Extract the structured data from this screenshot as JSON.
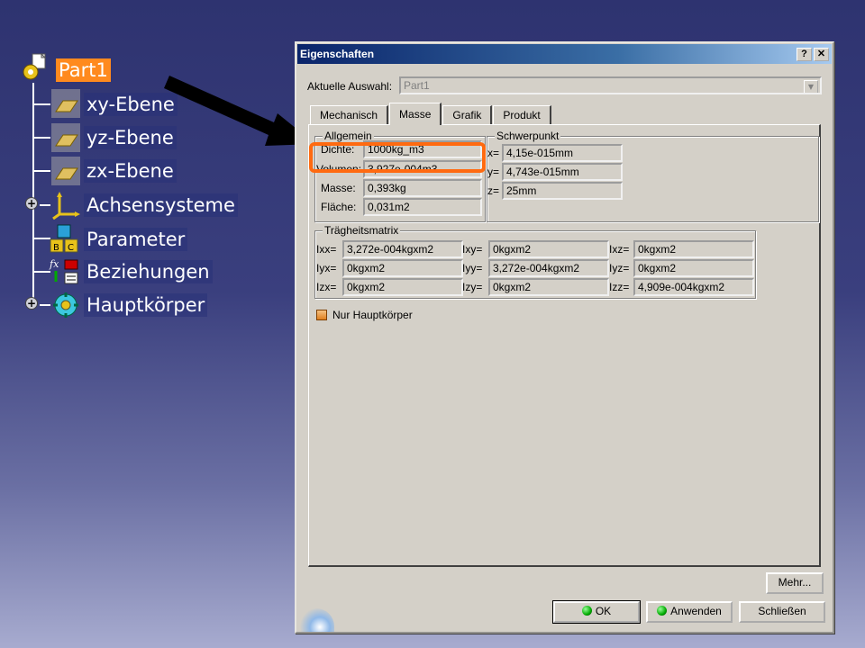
{
  "tree": {
    "root": "Part1",
    "items": [
      {
        "label": "xy-Ebene",
        "icon": "plane-icon"
      },
      {
        "label": "yz-Ebene",
        "icon": "plane-icon"
      },
      {
        "label": "zx-Ebene",
        "icon": "plane-icon"
      },
      {
        "label": "Achsensysteme",
        "icon": "axis-system-icon"
      },
      {
        "label": "Parameter",
        "icon": "parameter-icon"
      },
      {
        "label": "Beziehungen",
        "icon": "relations-icon"
      },
      {
        "label": "Hauptkörper",
        "icon": "body-icon"
      }
    ],
    "selection_color": "#ff8a1e"
  },
  "dialog": {
    "title": "Eigenschaften",
    "help_btn": "?",
    "close_btn": "✕",
    "selection_label": "Aktuelle Auswahl:",
    "selection_value": "Part1",
    "tabs": [
      "Mechanisch",
      "Masse",
      "Grafik",
      "Produkt"
    ],
    "active_tab": "Masse",
    "allgemein": {
      "title": "Allgemein",
      "dichte_label": "Dichte:",
      "dichte_value": "1000kg_m3",
      "volumen_label": "Volumen:",
      "volumen_value": "3,927e-004m3",
      "masse_label": "Masse:",
      "masse_value": "0,393kg",
      "flaeche_label": "Fläche:",
      "flaeche_value": "0,031m2"
    },
    "schwerpunkt": {
      "title": "Schwerpunkt",
      "x_label": "x=",
      "x_value": "4,15e-015mm",
      "y_label": "y=",
      "y_value": "4,743e-015mm",
      "z_label": "z=",
      "z_value": "25mm"
    },
    "traegheit": {
      "title": "Trägheitsmatrix",
      "ixx_label": "Ixx=",
      "ixx": "3,272e-004kgxm2",
      "ixy_label": "Ixy=",
      "ixy": "0kgxm2",
      "ixz_label": "Ixz=",
      "ixz": "0kgxm2",
      "iyx_label": "Iyx=",
      "iyx": "0kgxm2",
      "iyy_label": "Iyy=",
      "iyy": "3,272e-004kgxm2",
      "iyz_label": "Iyz=",
      "iyz": "0kgxm2",
      "izx_label": "Izx=",
      "izx": "0kgxm2",
      "izy_label": "Izy=",
      "izy": "0kgxm2",
      "izz_label": "Izz=",
      "izz": "4,909e-004kgxm2"
    },
    "checkbox_label": "Nur Hauptkörper",
    "buttons": {
      "mehr": "Mehr...",
      "ok": "OK",
      "anwenden": "Anwenden",
      "schliessen": "Schließen"
    },
    "highlight_color": "#ff6a10"
  }
}
